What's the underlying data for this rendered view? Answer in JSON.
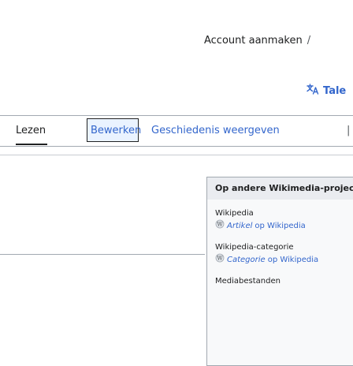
{
  "header": {
    "account_link": "Account aanmaken",
    "account_separator": "/",
    "language_button": "Tale",
    "language_icon": "translate-icon"
  },
  "tabs": {
    "read": "Lezen",
    "edit": "Bewerken",
    "history": "Geschiedenis weergeven",
    "more": "|"
  },
  "sister_projects": {
    "title": "Op andere Wikimedia-projec",
    "items": [
      {
        "name": "Wikipedia",
        "link": "Artikel",
        "suffix": "op Wikipedia",
        "icon": "wikipedia-icon"
      },
      {
        "name": "Wikipedia-categorie",
        "link": "Categorie",
        "suffix": "op Wikipedia",
        "icon": "wikipedia-icon"
      },
      {
        "name": "Mediabestanden"
      }
    ]
  },
  "colors": {
    "link": "#3366cc",
    "text": "#202122",
    "border": "#a2a9b1",
    "box_bg": "#f8f9fa",
    "box_header_bg": "#eaecf0"
  }
}
